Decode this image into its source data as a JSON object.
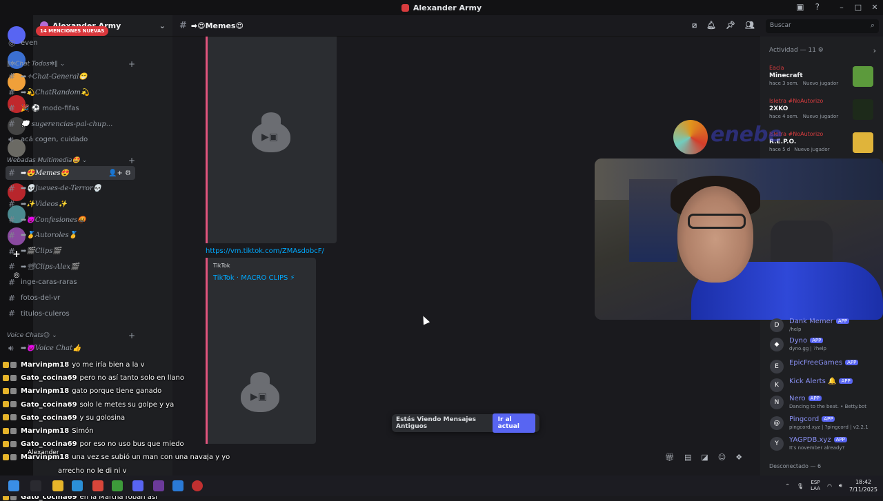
{
  "window": {
    "title": "Alexander Army"
  },
  "servers": [
    {
      "label": "",
      "color": "#5865f2",
      "badge": ""
    },
    {
      "label": "",
      "color": "#3b6fd0",
      "badge": "50"
    },
    {
      "label": "",
      "color": "#f0a03a",
      "badge": "1"
    },
    {
      "label": "",
      "color": "#c0282c",
      "badge": ""
    },
    {
      "label": "",
      "color": "#444",
      "badge": "252"
    },
    {
      "label": "",
      "color": "#6b6a64",
      "badge": ""
    },
    {
      "label": "OG",
      "color": "#121214",
      "badge": ""
    },
    {
      "label": "",
      "color": "#b8262c",
      "badge": "14"
    },
    {
      "label": "",
      "color": "#4b8a90",
      "badge": ""
    },
    {
      "label": "",
      "color": "#8a4aa0",
      "badge": "489"
    }
  ],
  "guild": {
    "name": "Alexander Army",
    "mentions": "14 MENCIONES NUEVAS"
  },
  "channels_top": [
    {
      "name": "even",
      "plain": true
    },
    {
      "category": "‖✲Chat Todos✲‖"
    },
    {
      "name": "➡✧Chat-General😁"
    },
    {
      "name": "➡💫ChatRandom💫"
    },
    {
      "name": "🎉 ⚽ modo-fifas",
      "plain": true
    },
    {
      "name": "💭 sugerencias-pal-chup..."
    },
    {
      "name": "acá cogen, cuidado",
      "plain": true,
      "voice": true
    }
  ],
  "category_multimedia": "Webadas Multimedia🤩",
  "channels_multimedia": [
    {
      "name": "➡😍Memes😍",
      "active": true
    },
    {
      "name": "➡💀Jueves-de-Terror💀"
    },
    {
      "name": "➡✨Videos✨"
    },
    {
      "name": "➡😈Confesiones🤬"
    },
    {
      "name": "➡🥇Autoroles🥇"
    },
    {
      "name": "➡🎬Clips🎬"
    },
    {
      "name": "➡📽Clips-Alex🎬"
    },
    {
      "name": "inge-caras-raras",
      "plain": true
    },
    {
      "name": "fotos-del-vr",
      "plain": true
    },
    {
      "name": "titulos-culeros",
      "plain": true
    }
  ],
  "category_voice": "Voice Chats😉",
  "channel_voice": "➡😈Voice Chat👍",
  "chat_header": {
    "channel": "➡😍Memes😍"
  },
  "search": {
    "placeholder": "Buscar"
  },
  "messages": {
    "link": "https://vm.tiktok.com/ZMAsdobcF/",
    "embed_provider": "TikTok",
    "embed_title": "TikTok · MACRO CLIPS ⚡"
  },
  "old_messages": {
    "text": "Estás Viendo Mensajes Antiguos",
    "button": "Ir al actual"
  },
  "composer": {
    "text": "z"
  },
  "activity": {
    "header": "Actividad — 11 ⚙",
    "items": [
      {
        "user": "Eacla",
        "game": "Minecraft",
        "time": "hace 3 sem.",
        "tag": "Nuevo jugador",
        "color": "#5c9a3c"
      },
      {
        "user": "Isletra #NoAutorizo",
        "game": "2XKO",
        "time": "hace 4 sem.",
        "tag": "Nuevo jugador",
        "color": "#1d2a1a"
      },
      {
        "user": "Isletra #NoAutorizo",
        "game": "R.E.P.O.",
        "time": "hace 5 d",
        "tag": "Nuevo jugador",
        "color": "#e0b43a"
      }
    ]
  },
  "overlay_logo": "enebe",
  "apps": [
    {
      "name": "Dank Memer",
      "status": "/help",
      "icon": "D"
    },
    {
      "name": "Dyno",
      "status": "dyno.gg | ?help",
      "icon": "◆"
    },
    {
      "name": "EpicFreeGames",
      "status": "",
      "icon": "E"
    },
    {
      "name": "Kick Alerts 🔔",
      "status": "",
      "icon": "K"
    },
    {
      "name": "Nero",
      "status": "Dancing to the beat. • Betty.bot",
      "icon": "N"
    },
    {
      "name": "Pingcord",
      "status": "pingcord.xyz | ?pingcord | v2.2.1",
      "icon": "@"
    },
    {
      "name": "YAGPDB.xyz",
      "status": "It's november already?",
      "icon": "Y"
    }
  ],
  "app_tag": "APP",
  "offline": "Desconectado — 6",
  "stream_chat": [
    {
      "user": "Marvinpm18",
      "msg": "yo me iría bien a la v"
    },
    {
      "user": "Gato_cocina69",
      "msg": "pero no así tanto solo en llano"
    },
    {
      "user": "Marvinpm18",
      "msg": "gato porque tiene ganado"
    },
    {
      "user": "Gato_cocina69",
      "msg": "solo le metes su golpe y ya"
    },
    {
      "user": "Gato_cocina69",
      "msg": "y su golosina"
    },
    {
      "user": "Marvinpm18",
      "msg": "Simón"
    },
    {
      "user": "Gato_cocina69",
      "msg": "por eso no uso bus que miedo"
    },
    {
      "user": "Marvinpm18",
      "msg": "una vez se subió un man con una navaja y yo"
    },
    {
      "user": "",
      "msg": "arrecho no le di ni v"
    },
    {
      "user": "Marvinpm18",
      "msg": "y tenía mi celular en mi bolsillo"
    },
    {
      "user": "Gato_cocina69",
      "msg": "en la Martha roban así"
    }
  ],
  "user_panel": {
    "name": "Alexander"
  },
  "tray": {
    "lang1": "ESP",
    "lang2": "LAA",
    "time": "18:42",
    "date": "7/11/2025"
  }
}
